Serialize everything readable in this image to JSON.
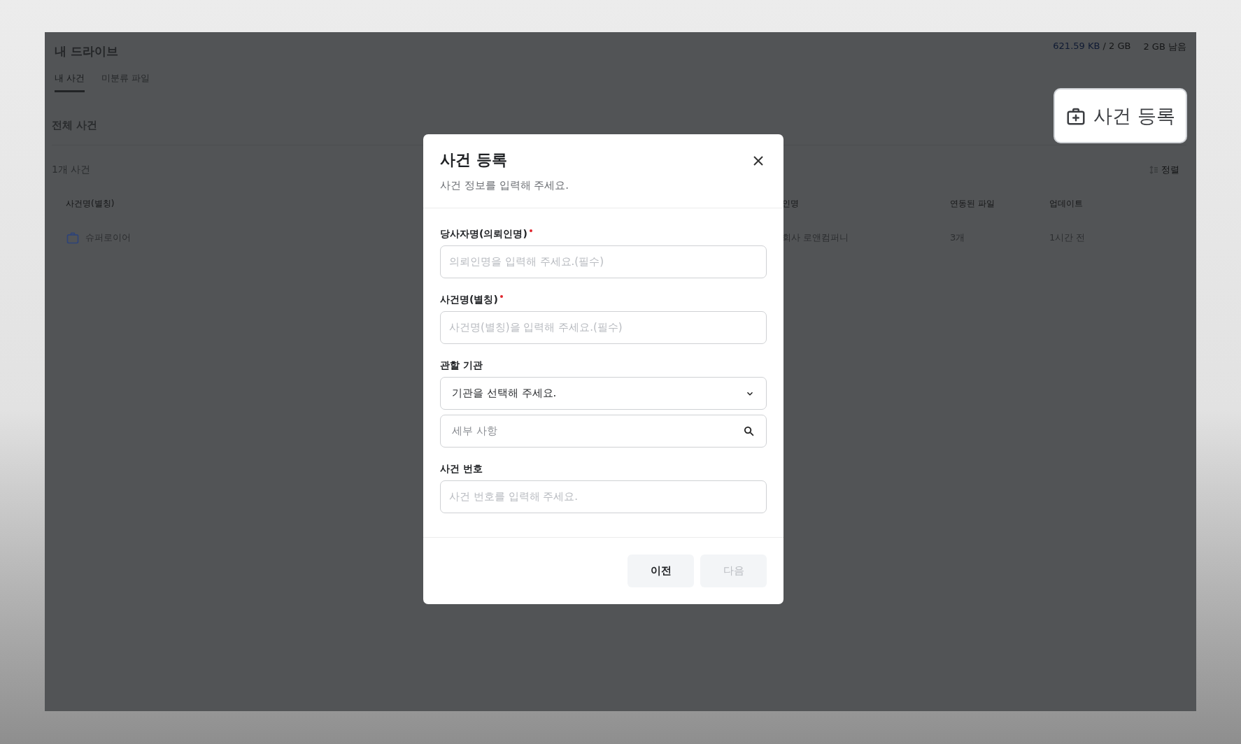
{
  "drive": {
    "title": "내 드라이브",
    "storage_used": "621.59 KB",
    "storage_total": "/ 2 GB",
    "storage_left": "2 GB 남음",
    "tabs": [
      {
        "label": "내 사건",
        "selected": true
      },
      {
        "label": "미분류 파일",
        "selected": false
      }
    ],
    "section_title": "전체 사건",
    "count": "1개 사건",
    "sort": "정렬",
    "table": {
      "columns": [
        "사건명(별칭)",
        "인명",
        "연동된 파일",
        "업데이트"
      ],
      "rows": [
        {
          "cells": [
            "슈퍼로이어",
            "회사 로앤컴퍼니",
            "3개",
            "1시간 전"
          ]
        }
      ]
    }
  },
  "register_button": {
    "label": "사건 등록"
  },
  "dialog": {
    "title": "사건 등록",
    "subtitle": "사건 정보를 입력해 주세요.",
    "fields": [
      {
        "label": "당사자명(의뢰인명)",
        "required": true,
        "inputs": [
          {
            "kind": "text",
            "placeholder": "의뢰인명을 입력해 주세요.(필수)"
          }
        ]
      },
      {
        "label": "사건명(별칭)",
        "required": true,
        "inputs": [
          {
            "kind": "text",
            "placeholder": "사건명(별칭)을 입력해 주세요.(필수)"
          }
        ]
      },
      {
        "label": "관할 기관",
        "required": false,
        "inputs": [
          {
            "kind": "select",
            "value": "기관을 선택해 주세요."
          },
          {
            "kind": "search",
            "placeholder": "세부 사항"
          }
        ]
      },
      {
        "label": "사건 번호",
        "required": false,
        "inputs": [
          {
            "kind": "text",
            "placeholder": "사건 번호를 입력해 주세요."
          }
        ]
      }
    ],
    "buttons": [
      {
        "label": "이전",
        "disabled": false
      },
      {
        "label": "다음",
        "disabled": true
      }
    ]
  }
}
